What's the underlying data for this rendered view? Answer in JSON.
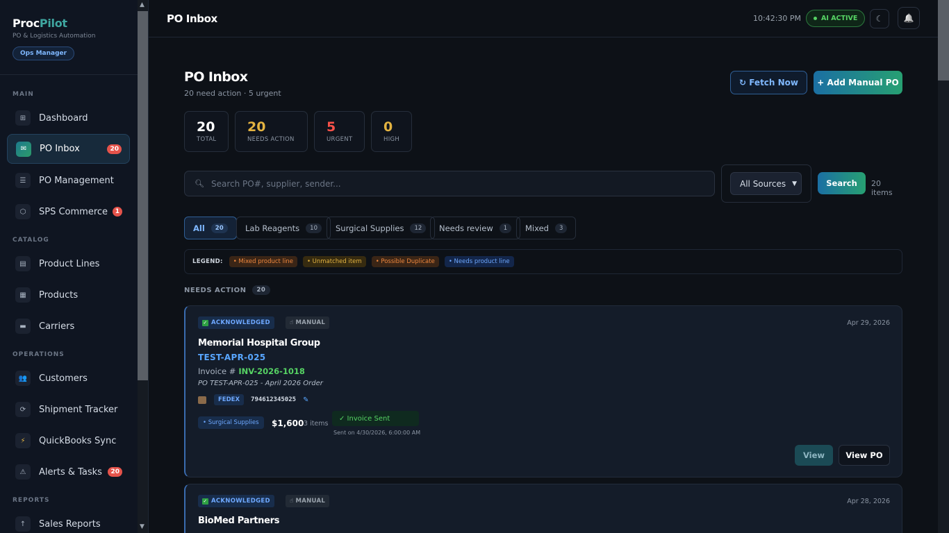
{
  "brand": {
    "name_part1": "Proc",
    "name_part2": "Pilot",
    "subtitle": "PO & Logistics Automation",
    "role": "Ops Manager"
  },
  "sidebar": {
    "sections": [
      "MAIN",
      "CATALOG",
      "OPERATIONS",
      "REPORTS"
    ],
    "items": [
      {
        "label": "Dashboard",
        "icon": "⊞"
      },
      {
        "label": "PO Inbox",
        "icon": "✉",
        "count": "20"
      },
      {
        "label": "PO Management",
        "icon": "☰"
      },
      {
        "label": "SPS Commerce",
        "icon": "⬡",
        "count": "1"
      },
      {
        "label": "Product Lines",
        "icon": "▤"
      },
      {
        "label": "Products",
        "icon": "▦"
      },
      {
        "label": "Carriers",
        "icon": "▬"
      },
      {
        "label": "Customers",
        "icon": "👥"
      },
      {
        "label": "Shipment Tracker",
        "icon": "⟳"
      },
      {
        "label": "QuickBooks Sync",
        "icon": "⚡"
      },
      {
        "label": "Alerts & Tasks",
        "icon": "⚠",
        "count": "20"
      },
      {
        "label": "Sales Reports",
        "icon": "↑"
      }
    ]
  },
  "topbar": {
    "title": "PO Inbox",
    "time": "10:42:30 PM",
    "ai_status": "AI ACTIVE",
    "theme_icon": "☾",
    "bell_icon": "🔔"
  },
  "page": {
    "title": "PO Inbox",
    "subtitle": "20 need action · 5 urgent",
    "fetch_label": "↻ Fetch Now",
    "add_label": "+ Add Manual PO"
  },
  "stats": [
    {
      "value": "20",
      "label": "TOTAL",
      "color": "#ffffff"
    },
    {
      "value": "20",
      "label": "NEEDS ACTION",
      "color": "#e3b341"
    },
    {
      "value": "5",
      "label": "URGENT",
      "color": "#f85149"
    },
    {
      "value": "0",
      "label": "HIGH",
      "color": "#e3b341"
    }
  ],
  "search": {
    "placeholder": "Search PO#, supplier, sender...",
    "source": "All Sources",
    "button": "Search",
    "items": "20 items"
  },
  "tabs": [
    {
      "label": "All",
      "count": "20"
    },
    {
      "label": "Lab Reagents",
      "count": "10"
    },
    {
      "label": "Surgical Supplies",
      "count": "12"
    },
    {
      "label": "Needs review",
      "count": "1"
    },
    {
      "label": "Mixed",
      "count": "3"
    }
  ],
  "legend": {
    "label": "LEGEND:",
    "chips": [
      "• Mixed product line",
      "• Unmatched item",
      "• Possible Duplicate",
      "• Needs product line"
    ]
  },
  "section": {
    "label": "NEEDS ACTION",
    "count": "20"
  },
  "cards": [
    {
      "status": "ACKNOWLEDGED",
      "source": "MANUAL",
      "date": "Apr 29, 2026",
      "customer": "Memorial Hospital Group",
      "po": "TEST-APR-025",
      "invoice_label": "Invoice #",
      "invoice": "INV-2026-1018",
      "description": "PO TEST-APR-025 - April 2026 Order",
      "carrier": "FEDEX",
      "tracking": "794612345025",
      "product_line": "• Surgical Supplies",
      "amount": "$1,600",
      "items": "3 items",
      "invoice_status": "✓ Invoice Sent",
      "sent_on": "Sent on 4/30/2026, 6:00:00 AM",
      "view": "View",
      "view_po": "View PO"
    },
    {
      "status": "ACKNOWLEDGED",
      "source": "MANUAL",
      "date": "Apr 28, 2026",
      "customer": "BioMed Partners"
    }
  ]
}
